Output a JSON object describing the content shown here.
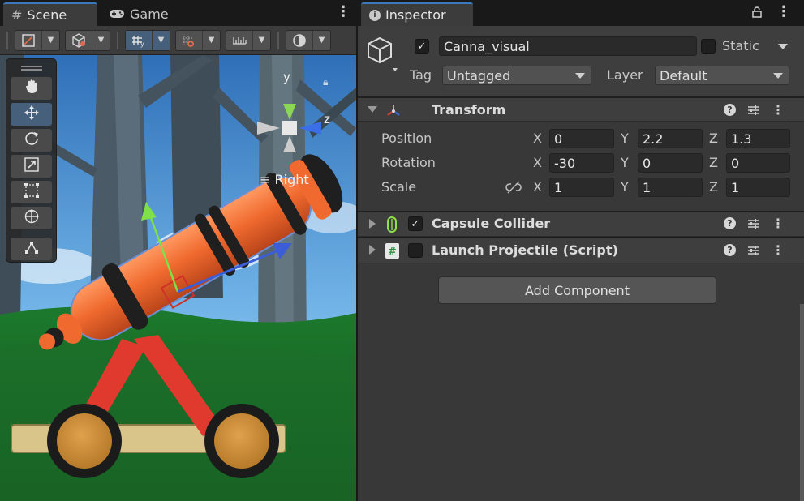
{
  "scene_tabs": [
    {
      "icon": "hash-icon",
      "label": "Scene"
    },
    {
      "icon": "gamepad-icon",
      "label": "Game"
    }
  ],
  "gizmo": {
    "y_label": "y",
    "z_label": "z",
    "view_label": "Right"
  },
  "inspector": {
    "tab_label": "Inspector",
    "object": {
      "active": true,
      "name": "Canna_visual",
      "static_label": "Static",
      "static": false,
      "tag_label": "Tag",
      "tag_value": "Untagged",
      "layer_label": "Layer",
      "layer_value": "Default"
    },
    "transform": {
      "title": "Transform",
      "position_label": "Position",
      "rotation_label": "Rotation",
      "scale_label": "Scale",
      "x_label": "X",
      "y_label": "Y",
      "z_label": "Z",
      "position": {
        "x": "0",
        "y": "2.2",
        "z": "1.3"
      },
      "rotation": {
        "x": "-30",
        "y": "0",
        "z": "0"
      },
      "scale": {
        "x": "1",
        "y": "1",
        "z": "1"
      }
    },
    "components": [
      {
        "title": "Capsule Collider",
        "enabled": true,
        "icon": "capsule-icon"
      },
      {
        "title": "Launch Projectile (Script)",
        "enabled": false,
        "icon": "script-hash-icon"
      }
    ],
    "add_component_label": "Add Component"
  },
  "colors": {
    "accent_blue": "#3a79bb",
    "selected_tool": "#46607c",
    "cannon_orange": "#e8642c"
  }
}
